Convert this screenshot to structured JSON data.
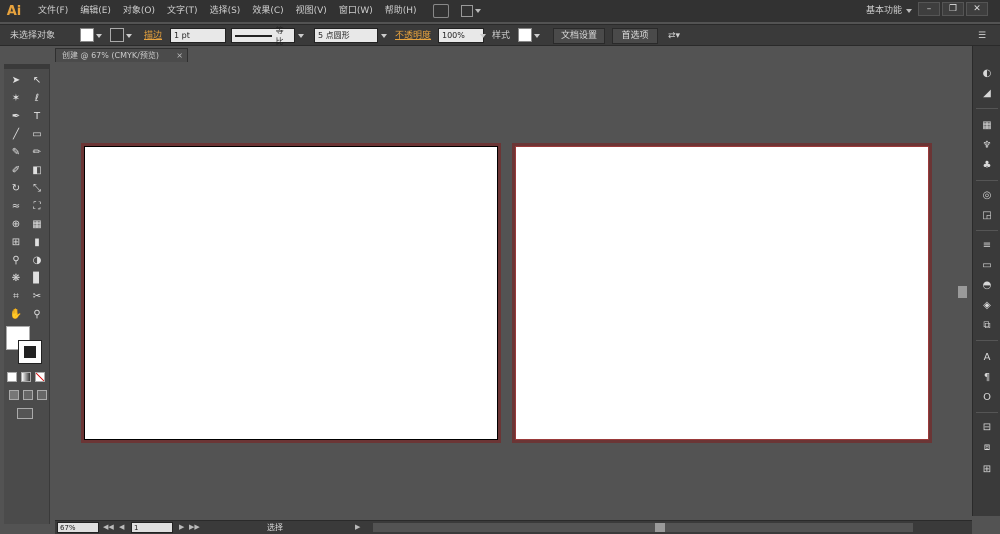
{
  "app": {
    "logo": "Ai",
    "menus": [
      "文件(F)",
      "编辑(E)",
      "对象(O)",
      "文字(T)",
      "选择(S)",
      "效果(C)",
      "视图(V)",
      "窗口(W)",
      "帮助(H)"
    ],
    "workspace": "基本功能",
    "window_buttons": [
      "–",
      "❐",
      "✕"
    ]
  },
  "control": {
    "selection": "未选择对象",
    "stroke_label": "描边",
    "stroke_weight": "1 pt",
    "stroke_style": "等比",
    "brush": "5 点圆形",
    "opacity_label": "不透明度",
    "opacity_value": "100%",
    "style_label": "样式",
    "doc_setup": "文档设置",
    "preferences": "首选项"
  },
  "document": {
    "tab_title": "创建 @ 67% (CMYK/预览)",
    "tab_close": "×"
  },
  "status": {
    "zoom": "67%",
    "artboard_number": "1",
    "tool_name": "选择",
    "nav_first": "◀◀",
    "nav_prev": "◀",
    "nav_next": "▶",
    "nav_last": "▶▶"
  },
  "colors": {
    "accent": "#e8a33d",
    "artboard_border": "#6b3535"
  },
  "tools": [
    "selection-icon",
    "direct-selection-icon",
    "magic-wand-icon",
    "lasso-icon",
    "pen-icon",
    "type-icon",
    "line-icon",
    "rectangle-icon",
    "paintbrush-icon",
    "pencil-icon",
    "blob-brush-icon",
    "eraser-icon",
    "rotate-icon",
    "scale-icon",
    "warp-icon",
    "free-transform-icon",
    "shape-builder-icon",
    "perspective-icon",
    "mesh-icon",
    "gradient-icon",
    "eyedropper-icon",
    "blend-icon",
    "symbol-sprayer-icon",
    "graph-icon",
    "artboard-icon",
    "slice-icon",
    "hand-icon",
    "zoom-icon"
  ]
}
